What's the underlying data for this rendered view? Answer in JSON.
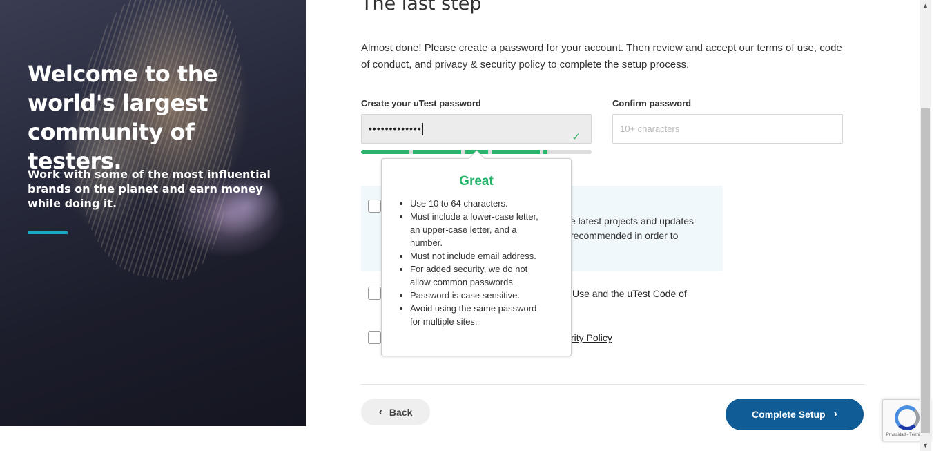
{
  "hero": {
    "title": "Welcome to the world's largest community of testers.",
    "subtitle": "Work with some of the most influential brands on the planet and earn money while doing it.",
    "accent_color": "#1aa7c7"
  },
  "form": {
    "step_title": "The last step",
    "intro": "Almost done! Please create a password for your account. Then review and accept our terms of use, code of conduct, and privacy & security policy to complete the setup process.",
    "password": {
      "label": "Create your uTest password",
      "value": "•••••••••••••",
      "status_icon": "check-icon"
    },
    "confirm": {
      "label": "Confirm password",
      "placeholder": "10+ characters"
    },
    "strength": {
      "level": 0.8,
      "color": "#26b36a"
    }
  },
  "consent": {
    "row1_text_a": "e latest projects and updates",
    "row1_text_b": "recommended in order to",
    "row2_link1": "Use",
    "row2_and": " and the ",
    "row2_link2": "uTest Code of",
    "row3_link": "rity Policy"
  },
  "popover": {
    "title": "Great",
    "title_color": "#26b36a",
    "rules": [
      "Use 10 to 64 characters.",
      "Must include a lower-case letter, an upper-case letter, and a number.",
      "Must not include email address.",
      "For added security, we do not allow common passwords.",
      "Password is case sensitive.",
      "Avoid using the same password for multiple sites."
    ]
  },
  "actions": {
    "back_label": "Back",
    "complete_label": "Complete Setup",
    "complete_color": "#0f5c96"
  },
  "recaptcha": {
    "text": "Privacidad - Términos"
  }
}
